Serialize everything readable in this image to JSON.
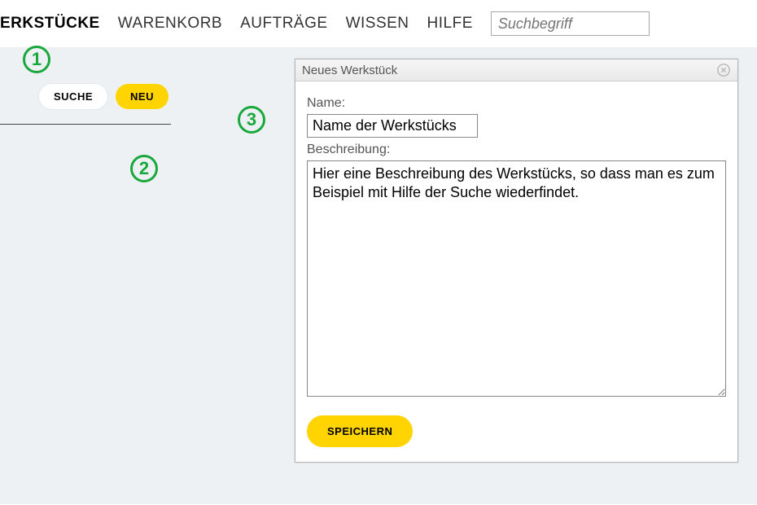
{
  "nav": {
    "items": [
      {
        "label": "ERKSTÜCKE",
        "active": true
      },
      {
        "label": "WARENKORB",
        "active": false
      },
      {
        "label": "AUFTRÄGE",
        "active": false
      },
      {
        "label": "WISSEN",
        "active": false
      },
      {
        "label": "HILFE",
        "active": false
      }
    ],
    "search_placeholder": "Suchbegriff"
  },
  "toolbar": {
    "suche_label": "SUCHE",
    "neu_label": "NEU"
  },
  "annotations": {
    "a1": "1",
    "a2": "2",
    "a3": "3"
  },
  "dialog": {
    "title": "Neues Werkstück",
    "name_label": "Name:",
    "name_value": "Name der Werkstücks",
    "desc_label": "Beschreibung:",
    "desc_value": "Hier eine Beschreibung des Werkstücks, so dass man es zum Beispiel mit Hilfe der Suche wiederfindet.",
    "save_label": "SPEICHERN"
  }
}
